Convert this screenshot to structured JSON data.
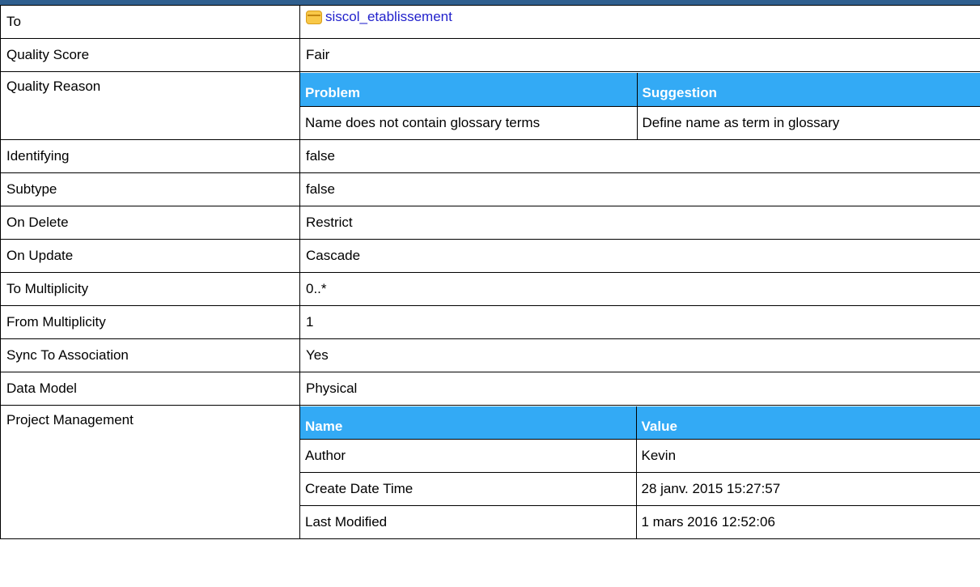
{
  "rows": {
    "to": {
      "label": "To",
      "value": "siscol_etablissement",
      "icon": "table-icon"
    },
    "quality_score": {
      "label": "Quality Score",
      "value": "Fair"
    },
    "quality_reason": {
      "label": "Quality Reason",
      "headers": [
        "Problem",
        "Suggestion"
      ],
      "rows": [
        [
          "Name does not contain glossary terms",
          "Define name as term in glossary"
        ]
      ]
    },
    "identifying": {
      "label": "Identifying",
      "value": "false"
    },
    "subtype": {
      "label": "Subtype",
      "value": "false"
    },
    "on_delete": {
      "label": "On Delete",
      "value": "Restrict"
    },
    "on_update": {
      "label": "On Update",
      "value": "Cascade"
    },
    "to_multiplicity": {
      "label": "To Multiplicity",
      "value": "0..*"
    },
    "from_multiplicity": {
      "label": "From Multiplicity",
      "value": "1"
    },
    "sync_to_association": {
      "label": "Sync To Association",
      "value": "Yes"
    },
    "data_model": {
      "label": "Data Model",
      "value": "Physical"
    },
    "project_management": {
      "label": "Project Management",
      "headers": [
        "Name",
        "Value"
      ],
      "rows": [
        [
          "Author",
          "Kevin"
        ],
        [
          "Create Date Time",
          "28 janv. 2015 15:27:57"
        ],
        [
          "Last Modified",
          "1 mars 2016 12:52:06"
        ]
      ]
    }
  },
  "colors": {
    "header_bar": "#2f5f8f",
    "subtable_header": "#33aaf5",
    "link": "#2222cc"
  }
}
